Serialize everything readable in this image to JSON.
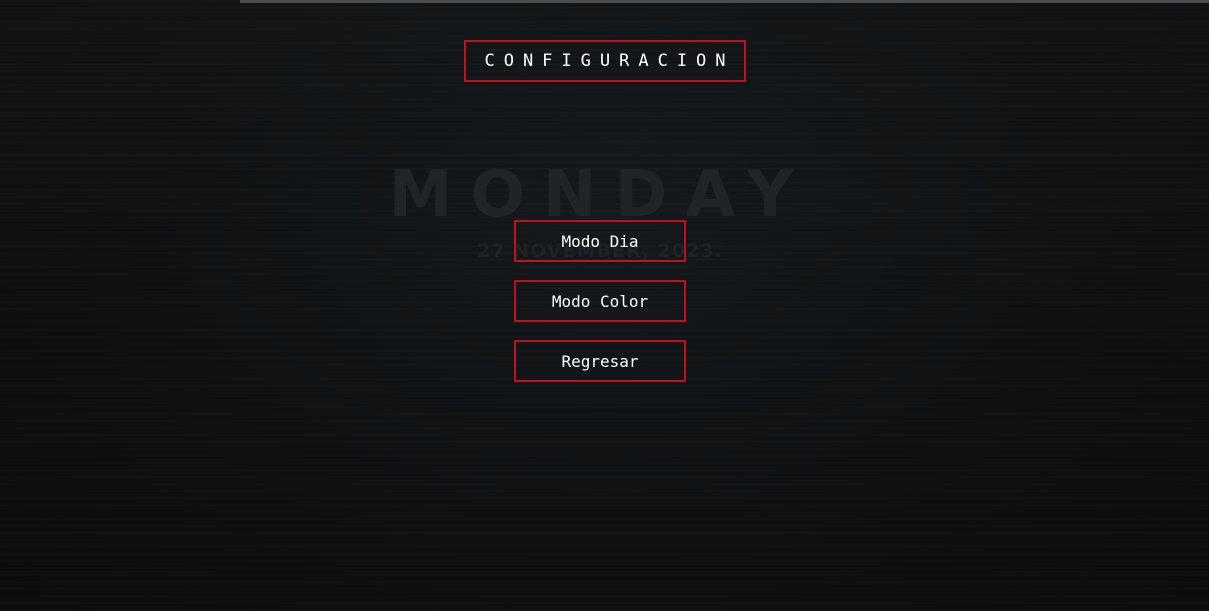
{
  "title": "CONFIGURACION",
  "menu": {
    "buttons": [
      {
        "label": "Modo Dia"
      },
      {
        "label": "Modo Color"
      },
      {
        "label": "Regresar"
      }
    ]
  },
  "wallpaper": {
    "day": "MONDAY",
    "date": "27 NOVEMBER, 2023."
  },
  "colors": {
    "accent": "#c1121c",
    "background": "#0d0f10",
    "text": "#ffffff"
  }
}
